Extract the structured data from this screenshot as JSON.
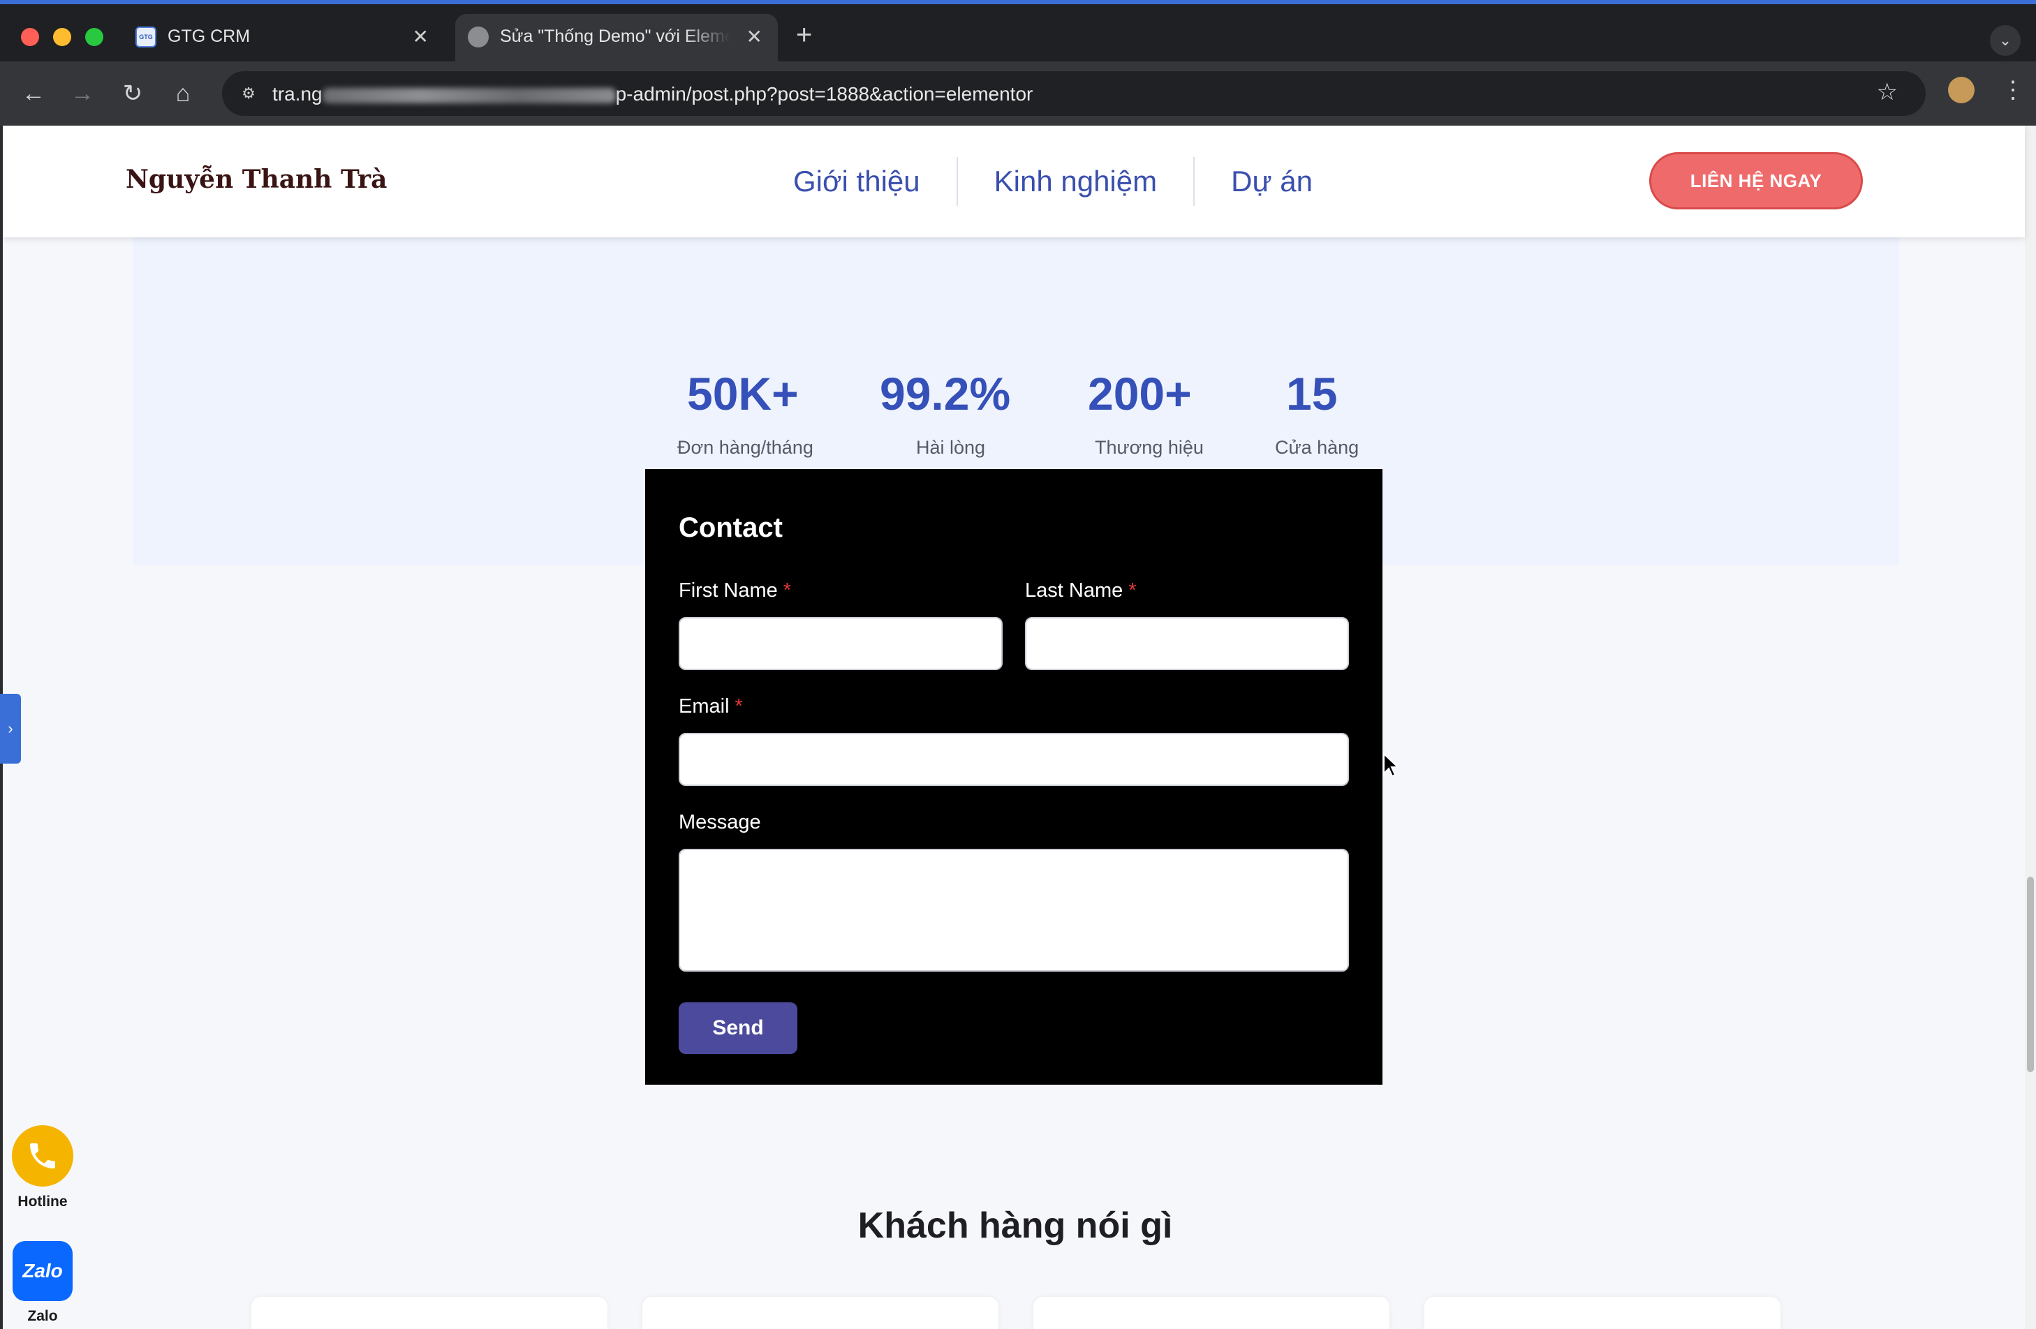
{
  "browser": {
    "tabs": [
      {
        "title": "GTG CRM",
        "favicon": "crm-favicon"
      },
      {
        "title": "Sửa \"Thống Demo\" với Elementor",
        "favicon": "globe-icon"
      }
    ],
    "address_bar": {
      "url_visible_suffix": "p-admin/post.php?post=1888&action=elementor",
      "url_prefix": "tra.ng"
    }
  },
  "site": {
    "logo": "Nguyễn Thanh Trà",
    "nav": [
      "Giới thiệu",
      "Kinh nghiệm",
      "Dự án"
    ],
    "cta": "LIÊN HỆ NGAY",
    "stats": [
      {
        "value": "50K+",
        "label": "Đơn hàng/tháng"
      },
      {
        "value": "99.2%",
        "label": "Hài lòng"
      },
      {
        "value": "200+",
        "label": "Thương hiệu"
      },
      {
        "value": "15",
        "label": "Cửa hàng"
      }
    ],
    "contact_form": {
      "title": "Contact",
      "first_name_label": "First Name",
      "last_name_label": "Last Name",
      "email_label": "Email",
      "message_label": "Message",
      "required_mark": "*",
      "first_name_value": "",
      "last_name_value": "",
      "email_value": "",
      "message_value": "",
      "submit": "Send"
    },
    "testimonials_title": "Khách hàng nói gì",
    "floating": {
      "hotline_label": "Hotline",
      "zalo_label": "Zalo",
      "zalo_logo_text": "Zalo"
    },
    "colors": {
      "accent": "#3550b8",
      "cta": "#ef6b6b",
      "send": "#4b4a9c"
    }
  }
}
